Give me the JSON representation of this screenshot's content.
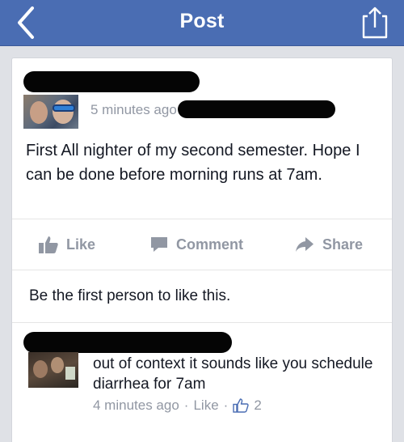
{
  "navbar": {
    "title": "Post",
    "bar_color": "#4a6db3",
    "back_icon": "chevron-left-icon",
    "share_icon": "share-icon"
  },
  "post": {
    "timestamp": "5 minutes ago",
    "text": "First All nighter of my second semester. Hope I can be done before morning runs at 7am."
  },
  "actions": {
    "like_label": "Like",
    "comment_label": "Comment",
    "share_label": "Share"
  },
  "likes_summary": "Be the first person to like this.",
  "comment": {
    "text": "out of context it sounds like you schedule diarrhea for 7am",
    "timestamp": "4 minutes ago",
    "separator": "·",
    "like_label": "Like",
    "like_count": "2"
  },
  "colors": {
    "accent": "#4a6db3",
    "meta_gray": "#9197a3",
    "background": "#dfe1e6"
  }
}
